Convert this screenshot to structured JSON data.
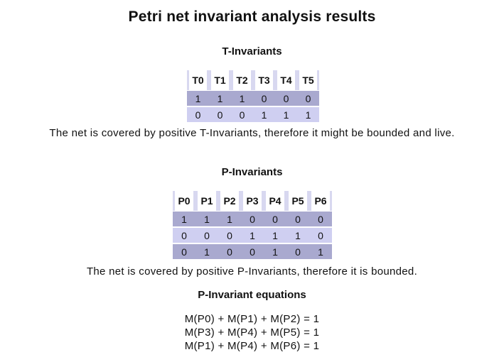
{
  "page_title": "Petri net invariant analysis results",
  "t_invariants": {
    "heading": "T-Invariants",
    "columns": [
      "T0",
      "T1",
      "T2",
      "T3",
      "T4",
      "T5"
    ],
    "rows": [
      [
        "1",
        "1",
        "1",
        "0",
        "0",
        "0"
      ],
      [
        "0",
        "0",
        "0",
        "1",
        "1",
        "1"
      ]
    ],
    "description": "The net is covered by positive T-Invariants, therefore it might be bounded and live."
  },
  "p_invariants": {
    "heading": "P-Invariants",
    "columns": [
      "P0",
      "P1",
      "P2",
      "P3",
      "P4",
      "P5",
      "P6"
    ],
    "rows": [
      [
        "1",
        "1",
        "1",
        "0",
        "0",
        "0",
        "0"
      ],
      [
        "0",
        "0",
        "0",
        "1",
        "1",
        "1",
        "0"
      ],
      [
        "0",
        "1",
        "0",
        "0",
        "1",
        "0",
        "1"
      ]
    ],
    "description": "The net is covered by positive P-Invariants, therefore it is bounded."
  },
  "equations": {
    "heading": "P-Invariant equations",
    "lines": [
      "M(P0) + M(P1) + M(P2) = 1",
      "M(P3) + M(P4) + M(P5) = 1",
      "M(P1) + M(P4) + M(P6) = 1"
    ]
  },
  "colors": {
    "row_dark": "#a9a9cf",
    "row_light": "#cfcff1",
    "header_divider": "#d8d8f0"
  }
}
